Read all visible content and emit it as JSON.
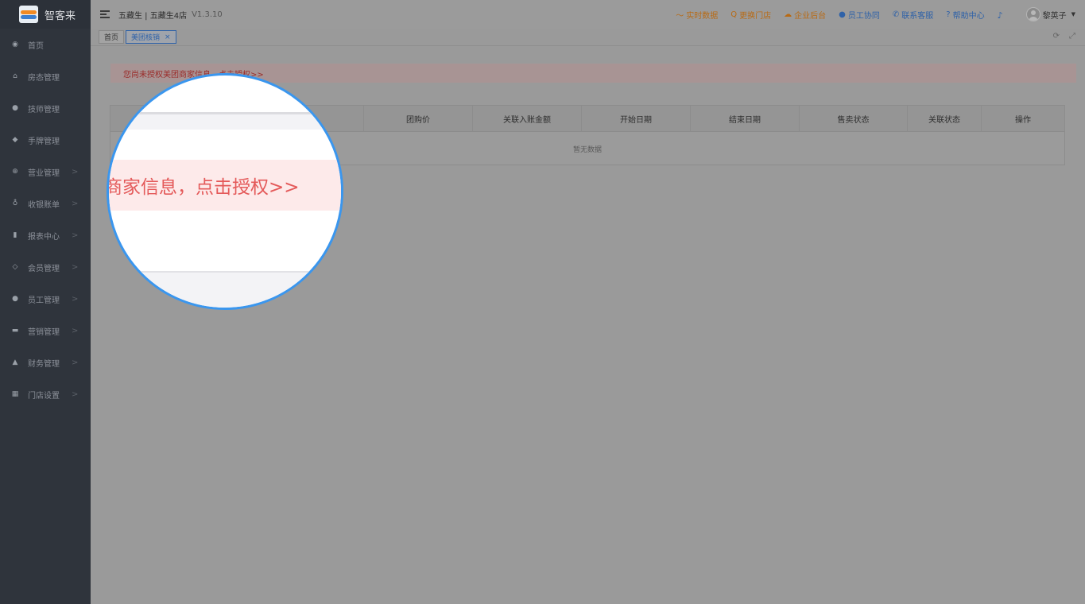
{
  "brand": {
    "name": "智客来"
  },
  "sidebar": {
    "items": [
      {
        "label": "首页",
        "icon": "dashboard-icon",
        "glyph": "◉",
        "has_children": false
      },
      {
        "label": "房态管理",
        "icon": "home-icon",
        "glyph": "⌂",
        "has_children": false
      },
      {
        "label": "技师管理",
        "icon": "user-icon",
        "glyph": "●",
        "has_children": false
      },
      {
        "label": "手牌管理",
        "icon": "tag-icon",
        "glyph": "◆",
        "has_children": false
      },
      {
        "label": "营业管理",
        "icon": "plus-circle-icon",
        "glyph": "⊕",
        "has_children": true
      },
      {
        "label": "收银账单",
        "icon": "money-bag-icon",
        "glyph": "♁",
        "has_children": true
      },
      {
        "label": "报表中心",
        "icon": "bar-chart-icon",
        "glyph": "▮",
        "has_children": true
      },
      {
        "label": "会员管理",
        "icon": "diamond-icon",
        "glyph": "◇",
        "has_children": true
      },
      {
        "label": "员工管理",
        "icon": "user-icon",
        "glyph": "●",
        "has_children": true
      },
      {
        "label": "营销管理",
        "icon": "briefcase-icon",
        "glyph": "▬",
        "has_children": true
      },
      {
        "label": "财务管理",
        "icon": "thumbs-up-icon",
        "glyph": "▲",
        "has_children": true
      },
      {
        "label": "门店设置",
        "icon": "grid-icon",
        "glyph": "▦",
        "has_children": true
      }
    ],
    "chevron": ">"
  },
  "header": {
    "store": "五藏生 | 五藏生4店",
    "version": "V1.3.10",
    "links": [
      {
        "label": "实时数据",
        "icon": "line-chart-icon",
        "glyph": "〜",
        "color": "orange"
      },
      {
        "label": "更换门店",
        "icon": "search-icon",
        "glyph": "Q",
        "color": "orange"
      },
      {
        "label": "企业后台",
        "icon": "cloud-icon",
        "glyph": "☁",
        "color": "orange"
      },
      {
        "label": "员工协同",
        "icon": "users-icon",
        "glyph": "●",
        "color": "blue"
      },
      {
        "label": "联系客服",
        "icon": "phone-icon",
        "glyph": "✆",
        "color": "blue"
      },
      {
        "label": "帮助中心",
        "icon": "help-icon",
        "glyph": "?",
        "color": "blue"
      }
    ],
    "user_name": "黎英子",
    "caret": "▼",
    "bell_glyph": "♪"
  },
  "tabs": {
    "home_label": "首页",
    "active_label": "美团核销",
    "close_glyph": "×",
    "refresh_glyph": "⟳",
    "fullscreen_glyph": "⤢"
  },
  "alert": {
    "text": "您尚未授权美团商家信息，",
    "link": "点击授权>>"
  },
  "table": {
    "columns": [
      {
        "label": ""
      },
      {
        "label": "团购价"
      },
      {
        "label": "关联入账金额"
      },
      {
        "label": "开始日期"
      },
      {
        "label": "结束日期"
      },
      {
        "label": "售卖状态"
      },
      {
        "label": "关联状态"
      },
      {
        "label": "操作"
      }
    ],
    "empty_text": "暂无数据"
  },
  "magnifier": {
    "text": "商家信息，点击授权>>"
  },
  "colors": {
    "accent": "#3a96ee",
    "sidebar_bg": "#2f343c",
    "alert_text": "#e45a5a",
    "alert_bg": "#fdeaea"
  }
}
